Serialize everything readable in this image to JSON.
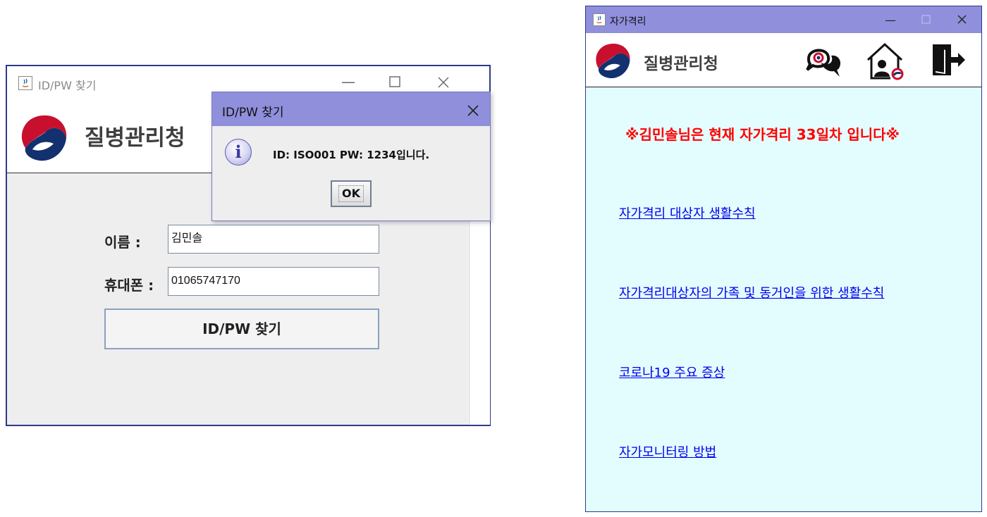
{
  "left_window": {
    "title": "ID/PW 찾기",
    "agency_name": "질병관리청",
    "form": {
      "name_label": "이름 :",
      "name_value": "김민솔",
      "phone_label": "휴대폰 :",
      "phone_value": "01065747170",
      "submit_label": "ID/PW 찾기"
    }
  },
  "dialog": {
    "title": "ID/PW 찾기",
    "message": "ID: ISO001 PW: 1234입니다.",
    "ok_label": "OK"
  },
  "right_window": {
    "title": "자가격리",
    "agency_name": "질병관리청",
    "notice": {
      "prefix": "※김민솔님은 현재 자가격리 ",
      "days": "33",
      "suffix": "일차 입니다※"
    },
    "links": [
      "자가격리 대상자 생활수칙",
      "자가격리대상자의 가족 및 동거인을 위한 생활수칙",
      "코로나19 주요 증상",
      "자가모니터링 방법"
    ],
    "toolbar_icons": [
      "chat-icon",
      "home-person-icon",
      "exit-door-icon"
    ]
  },
  "colors": {
    "titlebar": "#8f8fdb",
    "notice_red": "#ff0000",
    "link_blue": "#0000ee",
    "content_bg": "#e3fcfe",
    "form_bg": "#eeeeee"
  }
}
